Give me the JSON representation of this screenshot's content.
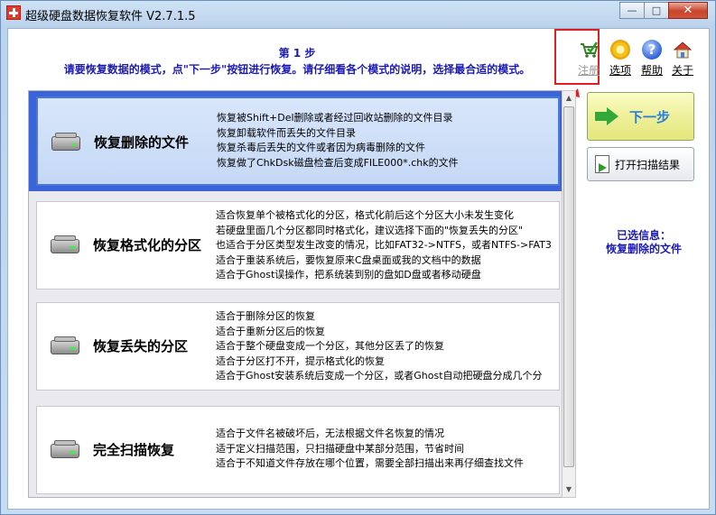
{
  "window": {
    "title": "超级硬盘数据恢复软件 V2.7.1.5",
    "min_label": "—",
    "max_label": "□",
    "close_label": "✕"
  },
  "header": {
    "step": "第 1 步",
    "description": "请要恢复数据的模式，点\"下一步\"按钮进行恢复。请仔细看各个模式的说明，选择最合适的模式。"
  },
  "toolbar": {
    "register": "注册",
    "options": "选项",
    "help": "帮助",
    "close": "关于"
  },
  "modes": [
    {
      "title": "恢复删除的文件",
      "selected": true,
      "desc": [
        "恢复被Shift+Del删除或者经过回收站删除的文件目录",
        "恢复卸载软件而丢失的文件目录",
        "恢复杀毒后丢失的文件或者因为病毒删除的文件",
        "恢复做了ChkDsk磁盘检查后变成FILE000*.chk的文件"
      ]
    },
    {
      "title": "恢复格式化的分区",
      "selected": false,
      "desc": [
        "适合恢复单个被格式化的分区，格式化前后这个分区大小未发生变化",
        "若硬盘里面几个分区都同时格式化，建议选择下面的\"恢复丢失的分区\"",
        "也适合于分区类型发生改变的情况，比如FAT32->NTFS，或者NTFS->FAT3",
        "适合于重装系统后，要恢复原来C盘桌面或我的文档中的数据",
        "适合于Ghost误操作，把系统装到别的盘如D盘或者移动硬盘"
      ]
    },
    {
      "title": "恢复丢失的分区",
      "selected": false,
      "desc": [
        "适合于删除分区的恢复",
        "适合于重新分区后的恢复",
        "适合于整个硬盘变成一个分区，其他分区丢了的恢复",
        "适合于分区打不开，提示格式化的恢复",
        "适合于Ghost安装系统后变成一个分区，或者Ghost自动把硬盘分成几个分"
      ]
    },
    {
      "title": "完全扫描恢复",
      "selected": false,
      "desc": [
        "适合于文件名被破坏后，无法根据文件名恢复的情况",
        "适于定义扫描范围，只扫描硬盘中某部分范围，节省时间",
        "适合于不知道文件存放在哪个位置，需要全部扫描出来再仔细查找文件"
      ]
    }
  ],
  "buttons": {
    "next": "下一步",
    "open_scan": "打开扫描结果"
  },
  "info": {
    "label": "已选信息：",
    "value": "恢复删除的文件"
  },
  "icons": {
    "register": "cart-icon",
    "options": "gear-icon",
    "help": "help-icon",
    "about": "home-icon",
    "disk": "hard-disk-icon"
  },
  "colors": {
    "accent_text": "#1b1bb3",
    "highlight": "#e02020",
    "selected_border": "#3a64d8"
  }
}
